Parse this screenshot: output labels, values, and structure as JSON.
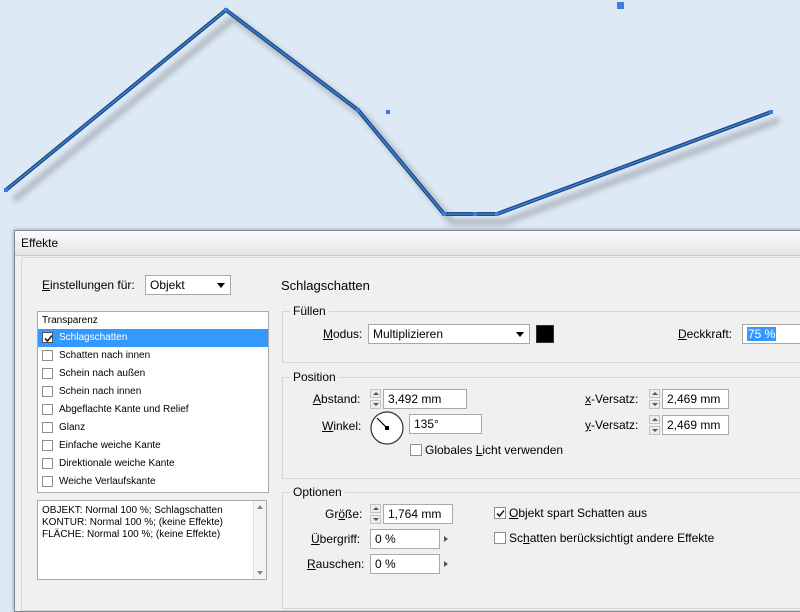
{
  "colors": {
    "canvas_bg": "#dde9f5",
    "stroke": "#1f4e8c",
    "handle": "#3a7fd5",
    "shadow": "#555555",
    "selection": "#3399ff",
    "swatch": "#000000"
  },
  "dialog": {
    "title": "Effekte",
    "settings_for_label_u": "E",
    "settings_for_label_rest": "instellungen für:",
    "settings_for_value": "Objekt",
    "list_header": "Transparenz",
    "effects": [
      {
        "label": "Schlagschatten",
        "checked": true,
        "selected": true
      },
      {
        "label": "Schatten nach innen",
        "checked": false,
        "selected": false
      },
      {
        "label": "Schein nach außen",
        "checked": false,
        "selected": false
      },
      {
        "label": "Schein nach innen",
        "checked": false,
        "selected": false
      },
      {
        "label": "Abgeflachte Kante und Relief",
        "checked": false,
        "selected": false
      },
      {
        "label": "Glanz",
        "checked": false,
        "selected": false
      },
      {
        "label": "Einfache weiche Kante",
        "checked": false,
        "selected": false
      },
      {
        "label": "Direktionale weiche Kante",
        "checked": false,
        "selected": false
      },
      {
        "label": "Weiche Verlaufskante",
        "checked": false,
        "selected": false
      }
    ],
    "summary_lines": [
      "OBJEKT: Normal 100 %; Schlagschatten",
      "KONTUR: Normal 100 %; (keine Effekte)",
      "FLÄCHE: Normal 100 %; (keine Effekte)"
    ],
    "section_title": "Schlagschatten",
    "fill": {
      "group_title": "Füllen",
      "mode_label_u": "M",
      "mode_label_rest": "odus:",
      "mode_value": "Multiplizieren",
      "opacity_label_u": "D",
      "opacity_label_rest": "eckkraft:",
      "opacity_value": "75 %"
    },
    "position": {
      "group_title": "Position",
      "distance_label_u": "A",
      "distance_label_rest": "bstand:",
      "distance_value": "3,492 mm",
      "angle_label_u": "W",
      "angle_label_rest": "inkel:",
      "angle_value": "135°",
      "global_light_pre": "Globales ",
      "global_light_u": "L",
      "global_light_rest": "icht verwenden",
      "global_light_checked": false,
      "x_offset_label_u": "x",
      "x_offset_label_rest": "-Versatz:",
      "x_offset_value": "2,469 mm",
      "y_offset_label_u": "y",
      "y_offset_label_rest": "-Versatz:",
      "y_offset_value": "2,469 mm"
    },
    "options": {
      "group_title": "Optionen",
      "size_label_pre": "Gr",
      "size_label_u": "ö",
      "size_label_rest": "ße:",
      "size_value": "1,764 mm",
      "spread_label_u": "Ü",
      "spread_label_rest": "bergriff:",
      "spread_value": "0 %",
      "noise_label_u": "R",
      "noise_label_rest": "auschen:",
      "noise_value": "0 %",
      "knockout_label_u": "O",
      "knockout_label_rest": "bjekt spart Schatten aus",
      "knockout_checked": true,
      "honor_label_pre": "Sc",
      "honor_label_u": "h",
      "honor_label_rest": "atten berücksichtigt andere Effekte",
      "honor_checked": false
    }
  }
}
